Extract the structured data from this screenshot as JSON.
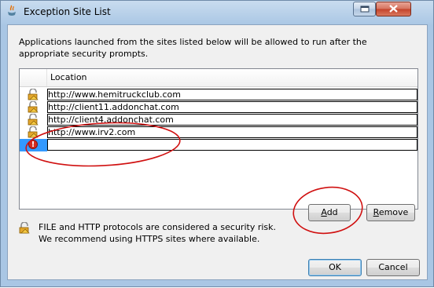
{
  "window": {
    "title": "Exception Site List"
  },
  "description": "Applications launched from the sites listed below will be allowed to run after the appropriate security prompts.",
  "table": {
    "column_header": "Location",
    "rows": [
      {
        "url": "http://www.hemitruckclub.com",
        "status_icon": "lock-warning-icon"
      },
      {
        "url": "http://client11.addonchat.com",
        "status_icon": "lock-warning-icon"
      },
      {
        "url": "http://client4.addonchat.com",
        "status_icon": "lock-warning-icon"
      },
      {
        "url": "http://www.irv2.com",
        "status_icon": "lock-warning-icon"
      },
      {
        "url": "",
        "status_icon": "error-icon",
        "selected": true
      }
    ]
  },
  "buttons": {
    "add_prefix": "",
    "add_mnemonic": "A",
    "add_rest": "dd",
    "remove_prefix": "",
    "remove_mnemonic": "R",
    "remove_rest": "emove",
    "ok": "OK",
    "cancel": "Cancel"
  },
  "security_note": {
    "line1": "FILE and HTTP protocols are considered a security risk.",
    "line2": "We recommend using HTTPS sites where available."
  },
  "colors": {
    "selection": "#3399ff",
    "annotation_red": "#d01010"
  }
}
